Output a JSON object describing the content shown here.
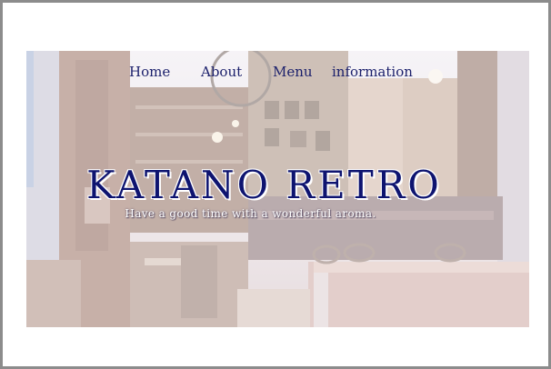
{
  "nav": {
    "items": [
      {
        "label": "Home"
      },
      {
        "label": "About"
      },
      {
        "label": "Menu"
      },
      {
        "label": "information"
      }
    ]
  },
  "hero": {
    "title": "KATANO RETRO",
    "tagline": "Have a good time with a wonderful aroma."
  },
  "colors": {
    "title": "#0e1470",
    "nav": "#1a1f6b",
    "frame_border": "#8c8c8c"
  },
  "icons": {
    "background": "restaurant-interior-photo"
  }
}
